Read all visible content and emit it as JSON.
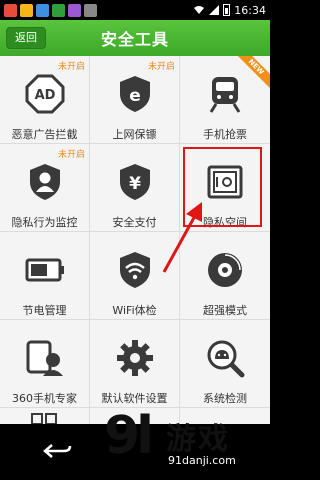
{
  "status_bar": {
    "time": "16:34",
    "colors": {
      "app1": "#e84b3c",
      "app2": "#f4b41a",
      "app3": "#3d8fe0",
      "app4": "#2e9f3b",
      "app5": "#9c59d1",
      "app6": "#888888"
    }
  },
  "header": {
    "back_label": "返回",
    "title": "安全工具"
  },
  "tools": [
    {
      "label": "恶意广告拦截",
      "tag": "未开启",
      "icon": "ad-block-icon"
    },
    {
      "label": "上网保镖",
      "tag": "未开启",
      "icon": "browser-shield-icon"
    },
    {
      "label": "手机抢票",
      "tag": "",
      "badge": "NEW",
      "icon": "train-icon"
    },
    {
      "label": "隐私行为监控",
      "tag": "未开启",
      "icon": "privacy-monitor-icon"
    },
    {
      "label": "安全支付",
      "tag": "",
      "icon": "secure-pay-icon"
    },
    {
      "label": "隐私空间",
      "tag": "",
      "icon": "safe-box-icon"
    },
    {
      "label": "节电管理",
      "tag": "",
      "icon": "battery-icon"
    },
    {
      "label": "WiFi体检",
      "tag": "",
      "icon": "wifi-shield-icon"
    },
    {
      "label": "超强模式",
      "tag": "",
      "icon": "disc-icon"
    },
    {
      "label": "360手机专家",
      "tag": "",
      "icon": "phone-expert-icon"
    },
    {
      "label": "默认软件设置",
      "tag": "",
      "icon": "gear-icon"
    },
    {
      "label": "系统检测",
      "tag": "",
      "icon": "android-search-icon"
    }
  ],
  "watermark": {
    "logo": "9l",
    "name": "游戏",
    "url": "91danji.com"
  },
  "accent": {
    "green": "#4cb831",
    "annotation_red": "#e01515",
    "tag_orange": "#f08a1c"
  }
}
